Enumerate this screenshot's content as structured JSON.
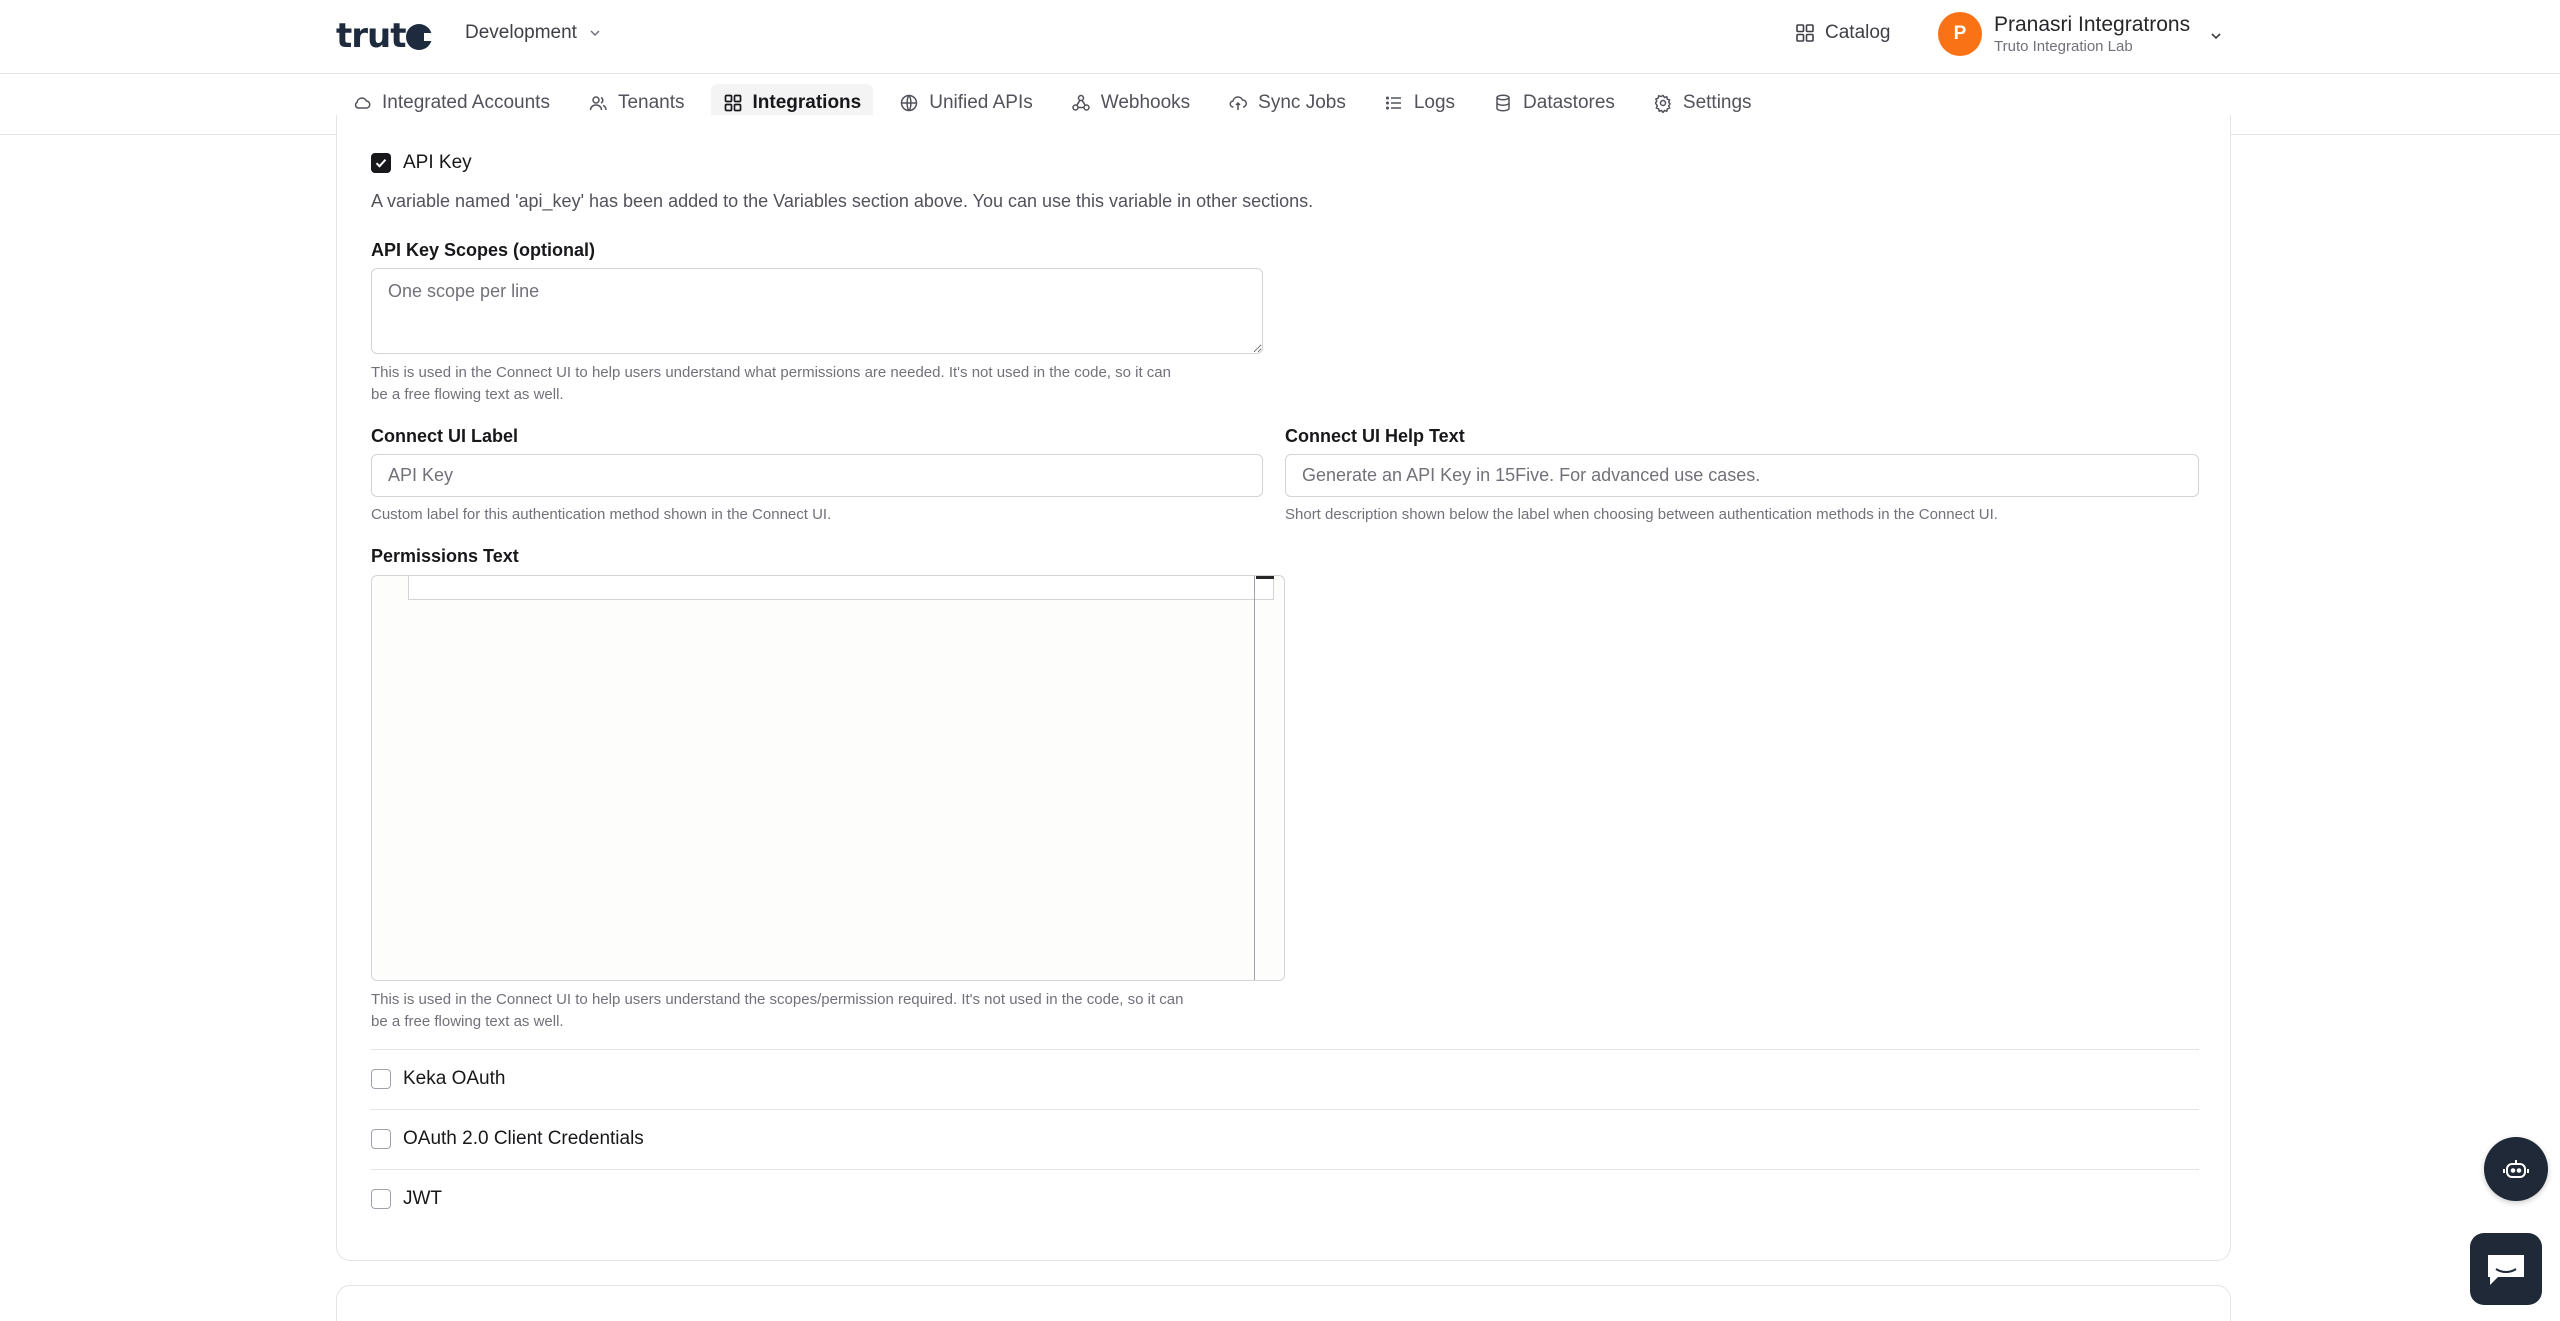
{
  "header": {
    "logo_text": "truto",
    "environment": "Development",
    "catalog_label": "Catalog",
    "user": {
      "initial": "P",
      "name": "Pranasri Integratrons",
      "org": "Truto Integration Lab",
      "avatar_color": "#f97316"
    }
  },
  "nav": {
    "items": [
      {
        "label": "Integrated Accounts",
        "icon": "cloud-icon"
      },
      {
        "label": "Tenants",
        "icon": "users-icon"
      },
      {
        "label": "Integrations",
        "icon": "grid-icon",
        "active": true
      },
      {
        "label": "Unified APIs",
        "icon": "globe-icon"
      },
      {
        "label": "Webhooks",
        "icon": "webhook-icon"
      },
      {
        "label": "Sync Jobs",
        "icon": "cloud-sync-icon"
      },
      {
        "label": "Logs",
        "icon": "list-icon"
      },
      {
        "label": "Datastores",
        "icon": "database-icon"
      },
      {
        "label": "Settings",
        "icon": "gear-icon"
      }
    ]
  },
  "api_key_section": {
    "checkbox_label": "API Key",
    "checked": true,
    "variable_note": "A variable named 'api_key' has been added to the Variables section above. You can use this variable in other sections.",
    "scopes": {
      "label": "API Key Scopes (optional)",
      "placeholder": "One scope per line",
      "hint_line1": "This is used in the Connect UI to help users understand what permissions are needed. It's not used in the code, so it can",
      "hint_line2": "be a free flowing text as well."
    },
    "connect_ui_label": {
      "label": "Connect UI Label",
      "placeholder": "API Key",
      "hint": "Custom label for this authentication method shown in the Connect UI."
    },
    "connect_ui_help": {
      "label": "Connect UI Help Text",
      "placeholder": "Generate an API Key in 15Five. For advanced use cases.",
      "hint": "Short description shown below the label when choosing between authentication methods in the Connect UI."
    },
    "permissions": {
      "label": "Permissions Text",
      "hint_line1": "This is used in the Connect UI to help users understand the scopes/permission required. It's not used in the code, so it can",
      "hint_line2": "be a free flowing text as well."
    }
  },
  "auth_options": [
    {
      "label": "Keka OAuth",
      "checked": false
    },
    {
      "label": "OAuth 2.0 Client Credentials",
      "checked": false
    },
    {
      "label": "JWT",
      "checked": false
    }
  ]
}
